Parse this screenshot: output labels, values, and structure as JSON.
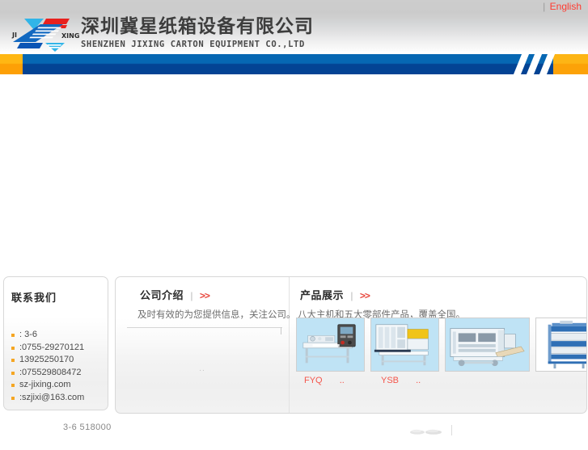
{
  "topbar": {
    "separator": "|",
    "english_label": "English"
  },
  "header": {
    "logo": {
      "left_text": "JI",
      "right_text": "XING",
      "icon": "jixing-z-logo"
    },
    "company_name_cn": "深圳冀星纸箱设备有限公司",
    "company_name_en": "SHENZHEN JIXING CARTON EQUIPMENT CO.,LTD"
  },
  "nav": {
    "items": ""
  },
  "banner": {
    "content": ""
  },
  "contact": {
    "title": "联系我们",
    "items": [
      ":                 3-6",
      ":0755-29270121",
      "  13925250170",
      ":075529808472",
      "  sz-jixing.com",
      ":szjixi@163.com"
    ]
  },
  "intro": {
    "title": "公司介绍",
    "separator": "|",
    "more": ">>",
    "subtitle": "及时有效的为您提供信息，关注公司。",
    "dots": ".."
  },
  "products": {
    "title": "产品展示",
    "separator": "|",
    "more": ">>",
    "subtitle": "八大主机和五大零部件产品，覆盖全国。",
    "items": [
      {
        "image": "carton-stitching-machine",
        "caption": "FYQ",
        "caption_suffix": ".."
      },
      {
        "image": "carton-creasing-machine",
        "caption": "YSB",
        "caption_suffix": ".."
      },
      {
        "image": "carton-printing-slotting-machine",
        "caption": "",
        "caption_suffix": ""
      },
      {
        "image": "carton-partition-slotter",
        "caption": "",
        "caption_suffix": ""
      }
    ]
  },
  "footer": {
    "address_line": "3-6   518000",
    "mark": "footer-graphic"
  },
  "colors": {
    "accent_blue": "#0667b3",
    "accent_blue_dark": "#034394",
    "accent_orange": "#ffb713",
    "accent_orange_dark": "#fda006",
    "link_red": "#e8463c",
    "caption_red": "#f4564c"
  }
}
